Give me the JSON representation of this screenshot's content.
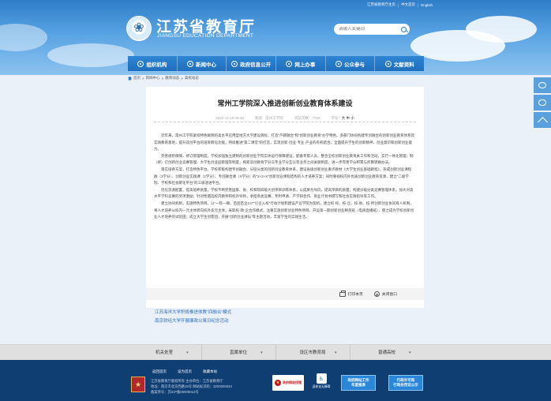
{
  "topbar": {
    "home_link": "江苏省教育厅主页",
    "lang_cn": "中文首页",
    "lang_en": "English",
    "sep": "|"
  },
  "header": {
    "title": "江苏省教育厅",
    "subtitle": "JIANGSU EDUCATION DEPARTMENT",
    "search_placeholder": "请输入关键词"
  },
  "nav": [
    {
      "label": "组织机构"
    },
    {
      "label": "新闻中心"
    },
    {
      "label": "政府信息公开"
    },
    {
      "label": "网上办事"
    },
    {
      "label": "公众参与"
    },
    {
      "label": "文献资料"
    }
  ],
  "breadcrumb": [
    "首页",
    "新闻中心",
    "教育动态",
    "高校动态"
  ],
  "breadcrumb_sep": ">",
  "article": {
    "title": "常州工学院深入推进创新创业教育体系建设",
    "date": "2020-12-19 09:49",
    "source": "来源：常州工学院",
    "views": "浏览次数：7755",
    "font_label": "字号：",
    "font_sizes": [
      "大",
      "中",
      "小"
    ],
    "paragraphs": [
      "近年来，常州工学院紧扣特色鲜明的高水平应用型地方大学建设目标，打造“产教融合”和“创新创业教育”办学特色，多部门协同构建专创融合的创新创业教育体系及实践教育基地，提升双创平台的培育孵化功能，持续推进“第二课堂”的打造，实现创新·创业·专业·产业的有机结合，全面提升学生的创新精神、创业意识和创新创业能力。",
      "完善组织保障，修订管理制度。学校加强独立建制的创新创业学院实体运行保障建设，配备专职人员，整合全校创新创业教育关工作和活动，实行一体化管理；制（修）订创新创业竞赛管理、大学生创业园管理等制度，探索双创教育学分与专业学分互认等业务之间关联制度，进一步完善学分积累与折算转换办法。",
      "落实培养方案，打造特色平台。学校积极构建专创融合、分层分类的创新创业教育体系，建设省级创新创业重点教材《大学生创业基础教程》，形成创新创业课程群（2学分）、创新创业实践课（2学分）、专创融合课（X学分）的“2+2+X”创新创业课程结构的人才培养方案；同时重视校内外优质创新创业教育资源，建立“二级学院、学校和社会孵化平台”的三级递进平台。",
      "优化资源配置，提高培养质量。学校不断完善国家、省、校和院四级大创项目训练体系，以成果为导向，提高项目的质量；构建分级分类竞赛管理体系，加大对高水平学科竞赛的奖项激励；针对性遴选校内教师和校外导师，承担各类竞赛、专利申请、产学研合作、商业计划书撰写和社会实践指导等工作。",
      "建立协同机制，实施特色项目。以“一院一镇，百团百企2.0”“引企入校”行动计划和建设产业学院为契机，建立校-校、校-企、校-地、校-所创新创业协同育人机制，将人才培养从校内一元主体转向校外多元主体，采取校-政-企合作模式，注重实施创新创业特色项目，开设第一期创新创业精英班（电商直播班），使之成为学校创新创业人才培养的试验田；成立大学生创客团，开展“创新创业讲坛”等主题活动，丰富学生的实践生活。"
    ],
    "print_label": "打印本页",
    "close_label": "关闭窗口"
  },
  "related": [
    "江苏海洋大学积极推进体教“四融合”模式",
    "南京财经大学开展廉政公寓日纪念活动"
  ],
  "links_bar": [
    "机关处室",
    "直属单位",
    "设区市教育局",
    "普通高校"
  ],
  "footer": {
    "links": [
      "返回首页",
      "设为首页",
      "收藏本站"
    ],
    "line1": "江苏省教育厅版权所有 主办单位：江苏省教育厅",
    "line2": "地址：南京市北京西路15号 网站标识码：3200000034",
    "line3": "备案序号：苏ICP备05009012号",
    "gov_badge": "政府网站找错",
    "lim_badge": "适老化无障碍",
    "badge_report_1": "政府网站工作",
    "badge_report_2": "年度报表",
    "badge_policy_1": "行政许可和",
    "badge_policy_2": "行政处罚双公示"
  },
  "colors": {
    "brand": "#2f7dc8",
    "nav": "#1e6ebd",
    "footer": "#0f3e73",
    "link": "#2f6cc0"
  }
}
